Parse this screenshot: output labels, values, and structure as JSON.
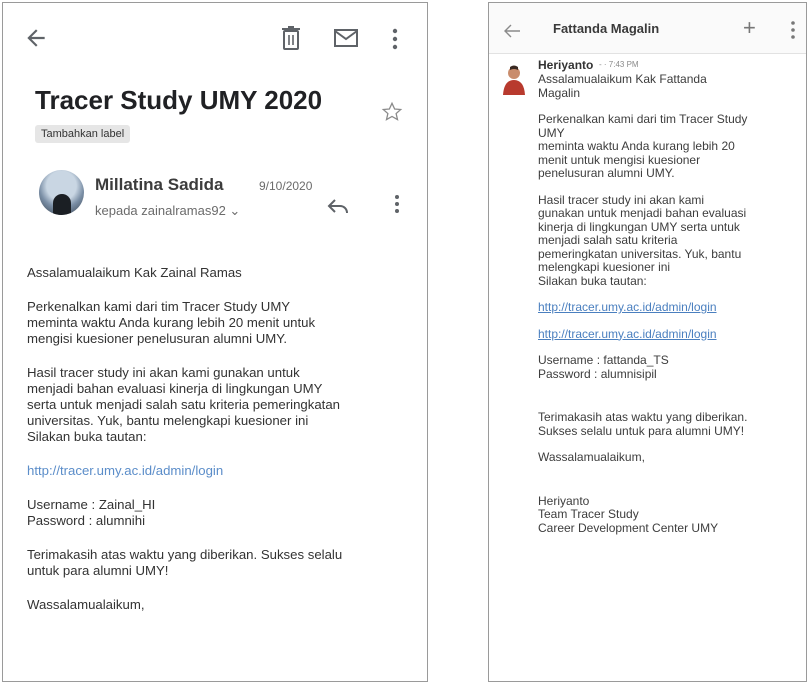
{
  "left": {
    "subject": "Tracer Study UMY 2020",
    "label_chip": "Tambahkan label",
    "sender": "Millatina Sadida",
    "date": "9/10/2020",
    "recipient": "kepada zainalramas92 ⌄",
    "paragraphs": [
      "Assalamualaikum Kak Zainal Ramas",
      "Perkenalkan kami dari tim Tracer Study UMY\nmeminta waktu Anda kurang lebih 20 menit untuk\nmengisi kuesioner penelusuran alumni UMY.",
      "Hasil tracer study ini akan kami gunakan untuk\nmenjadi bahan evaluasi kinerja di lingkungan UMY\nserta untuk menjadi salah satu kriteria pemeringkatan\nuniversitas. Yuk, bantu  melengkapi kuesioner ini\nSilakan buka tautan:"
    ],
    "link": "http://tracer.umy.ac.id/admin/login",
    "credentials": "Username : Zainal_HI\nPassword : alumnihi",
    "thanks": "Terimakasih atas waktu yang diberikan. Sukses selalu\nuntuk para alumni UMY!",
    "closing": "Wassalamualaikum,"
  },
  "right": {
    "title": "Fattanda Magalin",
    "plus_label": "+",
    "sender": "Heriyanto",
    "time": "- · 7:43 PM",
    "paragraphs": [
      "Assalamualaikum Kak Fattanda\nMagalin",
      "Perkenalkan kami dari tim Tracer Study\nUMY\nmeminta waktu Anda kurang lebih 20\nmenit untuk mengisi kuesioner\npenelusuran alumni UMY.",
      "Hasil tracer study ini akan kami\ngunakan untuk menjadi bahan evaluasi\nkinerja di lingkungan UMY serta untuk\nmenjadi salah satu kriteria\npemeringkatan universitas. Yuk, bantu\nmelengkapi kuesioner ini\nSilakan buka tautan:"
    ],
    "link1": "http://tracer.umy.ac.id/admin/login",
    "link2": "http://tracer.umy.ac.id/admin/login",
    "credentials": "Username : fattanda_TS\nPassword : alumnisipil",
    "thanks": "Terimakasih atas waktu yang diberikan.\nSukses selalu untuk para alumni UMY!",
    "closing": "Wassalamualaikum,",
    "signature": "Heriyanto\nTeam Tracer Study\nCareer Development Center UMY"
  },
  "colors": {
    "link": "#5b8dc9",
    "border": "#9a9a9a",
    "chip": "#e6e6e6"
  }
}
